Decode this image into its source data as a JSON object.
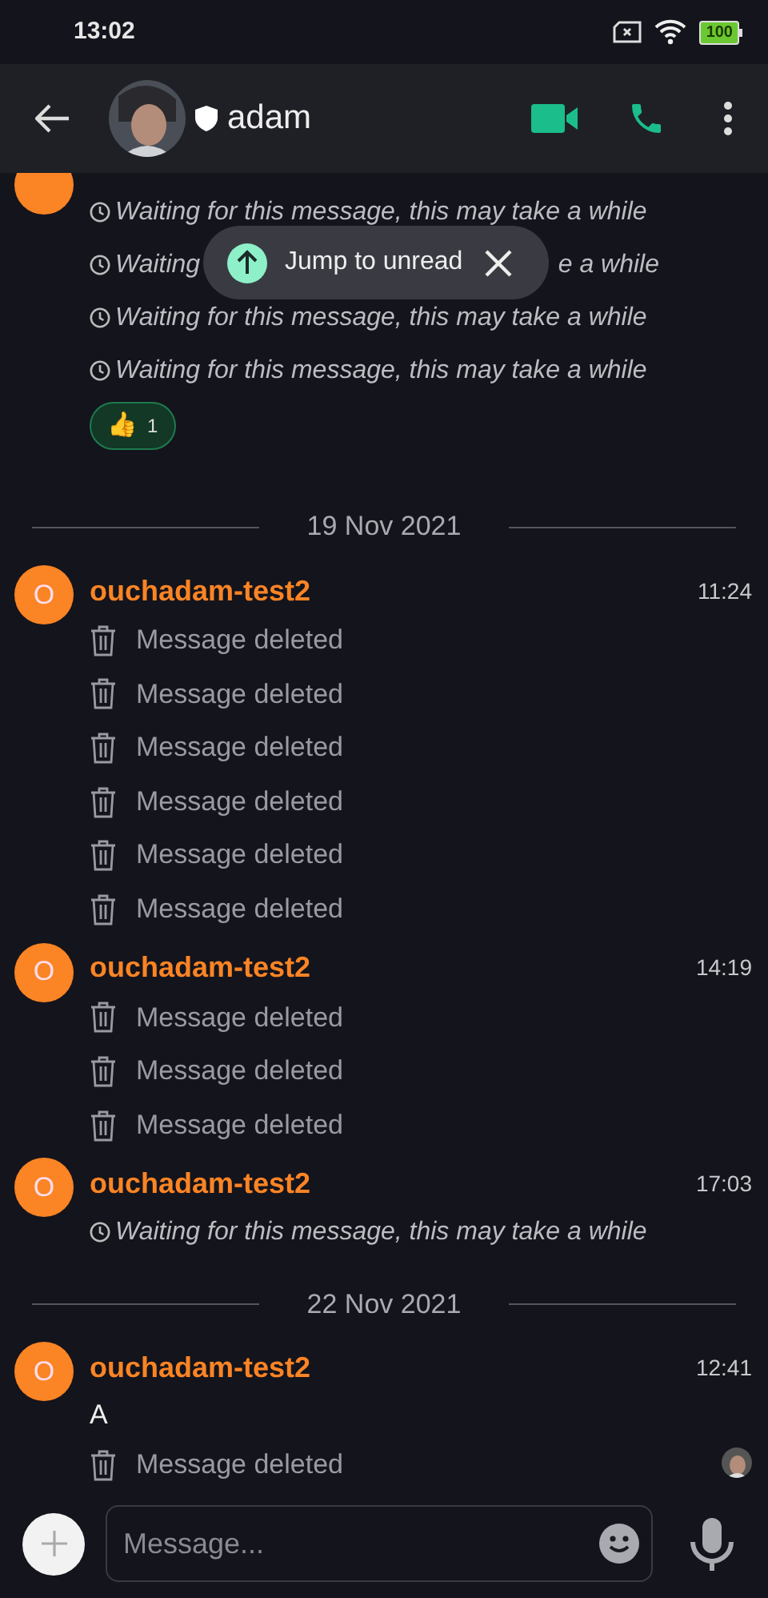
{
  "status_bar": {
    "time": "13:02",
    "battery": "100"
  },
  "header": {
    "title": "adam"
  },
  "jump_banner": {
    "label": "Jump to unread"
  },
  "timeline": [
    {
      "kind": "group",
      "items": [
        {
          "kind": "waiting",
          "text": "Waiting for this message, this may take a while"
        },
        {
          "kind": "waiting_covered",
          "text_start": "Waiting",
          "text_end": "e a while"
        },
        {
          "kind": "waiting",
          "text": "Waiting for this message, this may take a while"
        },
        {
          "kind": "waiting",
          "text": "Waiting for this message, this may take a while"
        }
      ],
      "reactions": [
        {
          "emoji": "👍",
          "count": "1",
          "selected": true
        }
      ]
    },
    {
      "kind": "date",
      "text": "19 Nov 2021"
    },
    {
      "kind": "group",
      "avatar": "O",
      "sender": "ouchadam-test2",
      "time": "11:24",
      "items": [
        {
          "kind": "deleted",
          "text": "Message deleted"
        },
        {
          "kind": "deleted",
          "text": "Message deleted"
        },
        {
          "kind": "deleted",
          "text": "Message deleted"
        },
        {
          "kind": "deleted",
          "text": "Message deleted"
        },
        {
          "kind": "deleted",
          "text": "Message deleted"
        },
        {
          "kind": "deleted",
          "text": "Message deleted"
        }
      ]
    },
    {
      "kind": "group",
      "avatar": "O",
      "sender": "ouchadam-test2",
      "time": "14:19",
      "items": [
        {
          "kind": "deleted",
          "text": "Message deleted"
        },
        {
          "kind": "deleted",
          "text": "Message deleted"
        },
        {
          "kind": "deleted",
          "text": "Message deleted"
        }
      ]
    },
    {
      "kind": "group",
      "avatar": "O",
      "sender": "ouchadam-test2",
      "time": "17:03",
      "items": [
        {
          "kind": "waiting",
          "text": "Waiting for this message, this may take a while"
        }
      ]
    },
    {
      "kind": "date",
      "text": "22 Nov 2021"
    },
    {
      "kind": "group",
      "avatar": "O",
      "sender": "ouchadam-test2",
      "time": "12:41",
      "items": [
        {
          "kind": "text",
          "text": "A"
        },
        {
          "kind": "deleted",
          "text": "Message deleted"
        }
      ]
    }
  ],
  "composer": {
    "placeholder": "Message..."
  }
}
